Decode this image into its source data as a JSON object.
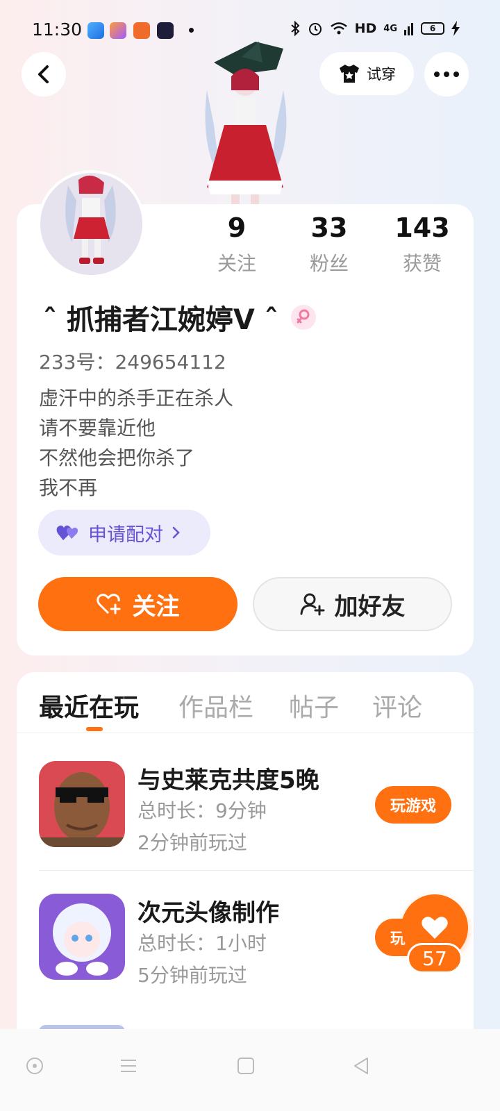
{
  "status_bar": {
    "time": "11:30",
    "network": "HD",
    "signal": "4G",
    "battery": "6",
    "app_icon_colors": [
      "#2f8ff0",
      "#f3a24a",
      "#f06a2a",
      "#1e1e3a"
    ],
    "icons": [
      "bluetooth-icon",
      "alarm-icon",
      "wifi-icon",
      "signal-icon",
      "battery-icon",
      "charging-icon"
    ]
  },
  "header": {
    "back_icon": "chevron-left-icon",
    "try_on_label": "试穿",
    "try_on_icon": "tshirt-icon",
    "more_icon": "more-dots-icon"
  },
  "profile": {
    "stats": [
      {
        "value": "9",
        "label": "关注"
      },
      {
        "value": "33",
        "label": "粉丝"
      },
      {
        "value": "143",
        "label": "获赞"
      }
    ],
    "username": "ˆ 抓捕者江婉婷ᐯ ˆ",
    "gender_icon": "female-icon",
    "uid": "233号：249654112",
    "bio": [
      "虚汗中的杀手正在杀人",
      "请不要靠近他",
      "不然他会把你杀了",
      "我不再"
    ],
    "pair_label": "申请配对",
    "follow_label": "关注",
    "add_friend_label": "加好友"
  },
  "tabs": [
    "最近在玩",
    "作品栏",
    "帖子",
    "评论"
  ],
  "games": [
    {
      "title": "与史莱克共度5晚",
      "duration": "总时长：9分钟",
      "last_played": "2分钟前玩过",
      "button": "玩游戏"
    },
    {
      "title": "次元头像制作",
      "duration": "总时长：1小时",
      "last_played": "5分钟前玩过",
      "button": "玩游戏"
    }
  ],
  "like": {
    "count": "57"
  },
  "colors": {
    "accent": "#ff7010",
    "pair": "#6553d6",
    "pair_bg": "#ecebfb",
    "gender": "#f07aa0"
  }
}
